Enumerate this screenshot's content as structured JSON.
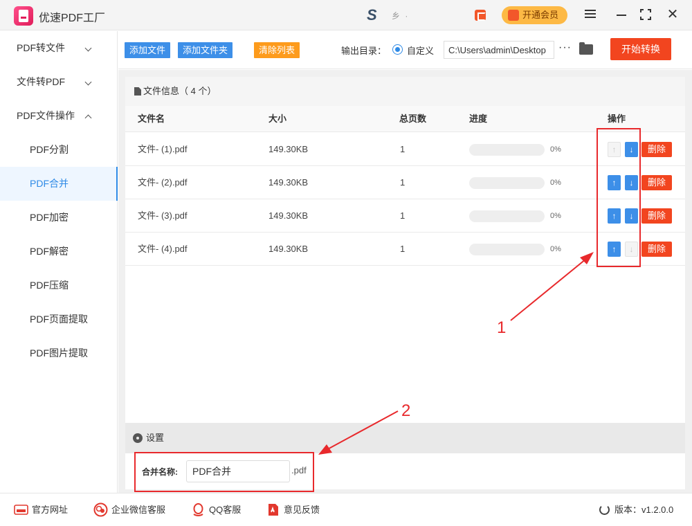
{
  "app": {
    "title": "优速PDF工厂",
    "user_name": "乡 ·"
  },
  "titlebar": {
    "vip_label": "开通会员"
  },
  "sidebar": {
    "groups": [
      {
        "label": "PDF转文件"
      },
      {
        "label": "文件转PDF"
      },
      {
        "label": "PDF文件操作"
      }
    ],
    "items": [
      {
        "label": "PDF分割"
      },
      {
        "label": "PDF合并"
      },
      {
        "label": "PDF加密"
      },
      {
        "label": "PDF解密"
      },
      {
        "label": "PDF压缩"
      },
      {
        "label": "PDF页面提取"
      },
      {
        "label": "PDF图片提取"
      }
    ],
    "active_item": "PDF合并"
  },
  "toolbar": {
    "add_file": "添加文件",
    "add_folder": "添加文件夹",
    "clear_list": "清除列表",
    "output_label": "输出目录：",
    "custom_label": "自定义",
    "output_path": "C:\\Users\\admin\\Desktop",
    "more": "···",
    "start": "开始转换"
  },
  "file_panel": {
    "title": "文件信息（ 4 个）",
    "columns": {
      "name": "文件名",
      "size": "大小",
      "pages": "总页数",
      "progress": "进度",
      "action": "操作"
    },
    "rows": [
      {
        "name": "文件- (1).pdf",
        "size": "149.30KB",
        "pages": "1",
        "progress": 0,
        "progress_text": "0%",
        "up_enabled": false,
        "down_enabled": true,
        "delete": "删除"
      },
      {
        "name": "文件- (2).pdf",
        "size": "149.30KB",
        "pages": "1",
        "progress": 0,
        "progress_text": "0%",
        "up_enabled": true,
        "down_enabled": true,
        "delete": "删除"
      },
      {
        "name": "文件- (3).pdf",
        "size": "149.30KB",
        "pages": "1",
        "progress": 0,
        "progress_text": "0%",
        "up_enabled": true,
        "down_enabled": true,
        "delete": "删除"
      },
      {
        "name": "文件- (4).pdf",
        "size": "149.30KB",
        "pages": "1",
        "progress": 0,
        "progress_text": "0%",
        "up_enabled": true,
        "down_enabled": false,
        "delete": "删除"
      }
    ]
  },
  "settings": {
    "title": "设置",
    "merge_label": "合并名称:",
    "merge_value": "PDF合并",
    "merge_ext": ".pdf"
  },
  "annotations": {
    "marker_1": "1",
    "marker_2": "2"
  },
  "footer": {
    "website": "官方网址",
    "wechat": "企业微信客服",
    "qq": "QQ客服",
    "feedback": "意见反馈",
    "version": "版本：v1.2.0.0"
  },
  "icons": {
    "arrow_up": "↑",
    "arrow_down": "↓",
    "close": "✕"
  },
  "colors": {
    "accent_blue": "#3d8fe8",
    "start_red": "#f2451f",
    "clear_orange": "#fd9b1c",
    "vip_gold": "#fdb945",
    "annotation_red": "#e8292c"
  }
}
